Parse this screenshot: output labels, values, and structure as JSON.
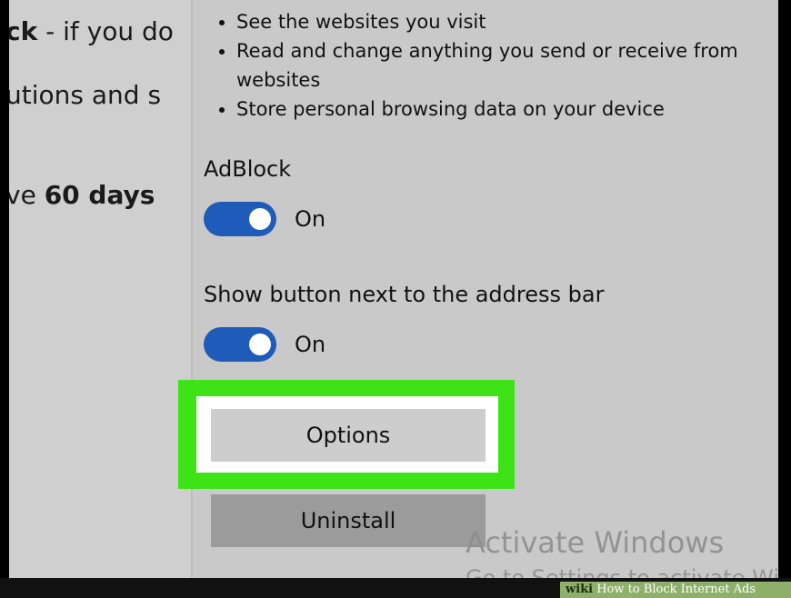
{
  "background_page": {
    "line1_bold": "ck",
    "line1_rest": " - if you do",
    "line2": "utions and s",
    "line3_prefix": "ve ",
    "line3_bold": "60 days"
  },
  "permissions": [
    "See the websites you visit",
    "Read and change anything you send or receive from websites",
    "Store personal browsing data on your device"
  ],
  "adblock": {
    "title": "AdBlock",
    "state": "On",
    "enabled": true
  },
  "show_button": {
    "title": "Show button next to the address bar",
    "state": "On",
    "enabled": true
  },
  "buttons": {
    "options": "Options",
    "uninstall": "Uninstall"
  },
  "activate_windows": {
    "line1": "Activate Windows",
    "line2": "Go to Settings to activate Windows."
  },
  "wiki_banner": {
    "brand": "wiki",
    "text": "How to Block Internet Ads"
  },
  "colors": {
    "toggle_on": "#1f5bb8",
    "highlight": "#3ee317",
    "panel_bg": "#c9c9c9"
  }
}
